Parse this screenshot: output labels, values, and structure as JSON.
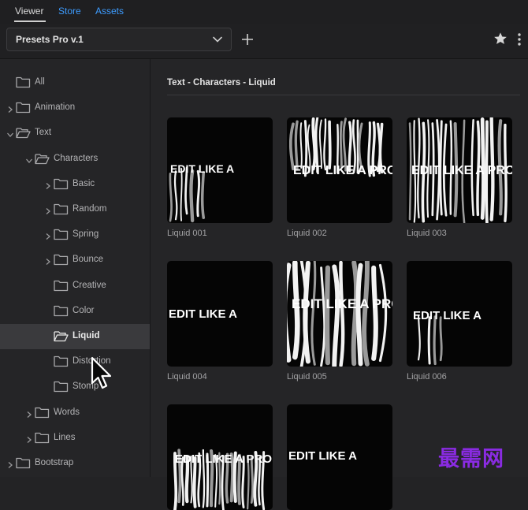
{
  "header": {
    "tabs": [
      {
        "label": "Viewer",
        "active": true
      },
      {
        "label": "Store",
        "active": false
      },
      {
        "label": "Assets",
        "active": false
      }
    ]
  },
  "toolbar": {
    "preset_label": "Presets Pro v.1",
    "icons": [
      "chevron-down-icon",
      "plus-icon",
      "star-icon",
      "more-vertical-icon"
    ]
  },
  "sidebar": {
    "items": [
      {
        "label": "All",
        "level": 0,
        "expandable": false,
        "expanded": false,
        "selected": false
      },
      {
        "label": "Animation",
        "level": 0,
        "expandable": true,
        "expanded": false,
        "selected": false
      },
      {
        "label": "Text",
        "level": 0,
        "expandable": true,
        "expanded": true,
        "selected": false
      },
      {
        "label": "Characters",
        "level": 1,
        "expandable": true,
        "expanded": true,
        "selected": false
      },
      {
        "label": "Basic",
        "level": 2,
        "expandable": true,
        "expanded": false,
        "selected": false
      },
      {
        "label": "Random",
        "level": 2,
        "expandable": true,
        "expanded": false,
        "selected": false
      },
      {
        "label": "Spring",
        "level": 2,
        "expandable": true,
        "expanded": false,
        "selected": false
      },
      {
        "label": "Bounce",
        "level": 2,
        "expandable": true,
        "expanded": false,
        "selected": false
      },
      {
        "label": "Creative",
        "level": 2,
        "expandable": false,
        "expanded": false,
        "selected": false
      },
      {
        "label": "Color",
        "level": 2,
        "expandable": false,
        "expanded": false,
        "selected": false
      },
      {
        "label": "Liquid",
        "level": 2,
        "expandable": false,
        "expanded": false,
        "selected": true
      },
      {
        "label": "Distortion",
        "level": 2,
        "expandable": false,
        "expanded": false,
        "selected": false
      },
      {
        "label": "Stomp",
        "level": 2,
        "expandable": false,
        "expanded": false,
        "selected": false
      },
      {
        "label": "Words",
        "level": 1,
        "expandable": true,
        "expanded": false,
        "selected": false
      },
      {
        "label": "Lines",
        "level": 1,
        "expandable": true,
        "expanded": false,
        "selected": false
      },
      {
        "label": "Bootstrap",
        "level": 0,
        "expandable": true,
        "expanded": false,
        "selected": false
      }
    ]
  },
  "main": {
    "breadcrumb": "Text - Characters - Liquid",
    "thumbnail_text": "EDIT LIKE A PRO",
    "thumbnail_text_partial": "EDIT LIKE A",
    "presets": [
      {
        "name": "Liquid 001"
      },
      {
        "name": "Liquid 002"
      },
      {
        "name": "Liquid 003"
      },
      {
        "name": "Liquid 004"
      },
      {
        "name": "Liquid 005"
      },
      {
        "name": "Liquid 006"
      },
      {
        "name": ""
      },
      {
        "name": ""
      }
    ]
  },
  "watermark": "最需网",
  "colors": {
    "accent_link": "#3d9cff",
    "selected_row": "#3a3a3d",
    "watermark": "#8a2be2"
  }
}
